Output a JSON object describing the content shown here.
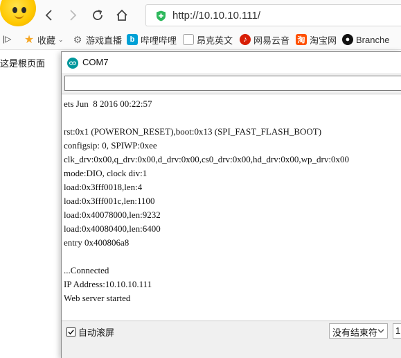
{
  "browser": {
    "url": "http://10.10.10.111/"
  },
  "bookmarks": [
    {
      "label": "收藏",
      "icon": "star-icon",
      "color": "#f5a623"
    },
    {
      "label": "游戏直播",
      "icon": "game-icon",
      "color": "#6b6b6b"
    },
    {
      "label": "哔哩哔哩",
      "icon": "bilibili-icon",
      "color": "#00a1d6"
    },
    {
      "label": "昂克英文",
      "icon": "page-icon",
      "color": "#9e9e9e"
    },
    {
      "label": "网易云音",
      "icon": "netease-music-icon",
      "color": "#d81e06"
    },
    {
      "label": "淘宝网",
      "icon": "taobao-icon",
      "color": "#ff5000"
    },
    {
      "label": "Branche",
      "icon": "github-icon",
      "color": "#111111"
    }
  ],
  "page": {
    "text": "这是根页面"
  },
  "serial_monitor": {
    "title": "COM7",
    "input_value": "",
    "lines": [
      "ets Jun  8 2016 00:22:57",
      "",
      "rst:0x1 (POWERON_RESET),boot:0x13 (SPI_FAST_FLASH_BOOT)",
      "configsip: 0, SPIWP:0xee",
      "clk_drv:0x00,q_drv:0x00,d_drv:0x00,cs0_drv:0x00,hd_drv:0x00,wp_drv:0x00",
      "mode:DIO, clock div:1",
      "load:0x3fff0018,len:4",
      "load:0x3fff001c,len:1100",
      "load:0x40078000,len:9232",
      "load:0x40080400,len:6400",
      "entry 0x400806a8",
      "",
      "...Connected",
      "IP Address:10.10.10.111",
      "Web server started"
    ],
    "autoscroll_label": "自动滚屏",
    "autoscroll_checked": true,
    "line_ending": "没有结束符",
    "baud_partial": "1"
  }
}
